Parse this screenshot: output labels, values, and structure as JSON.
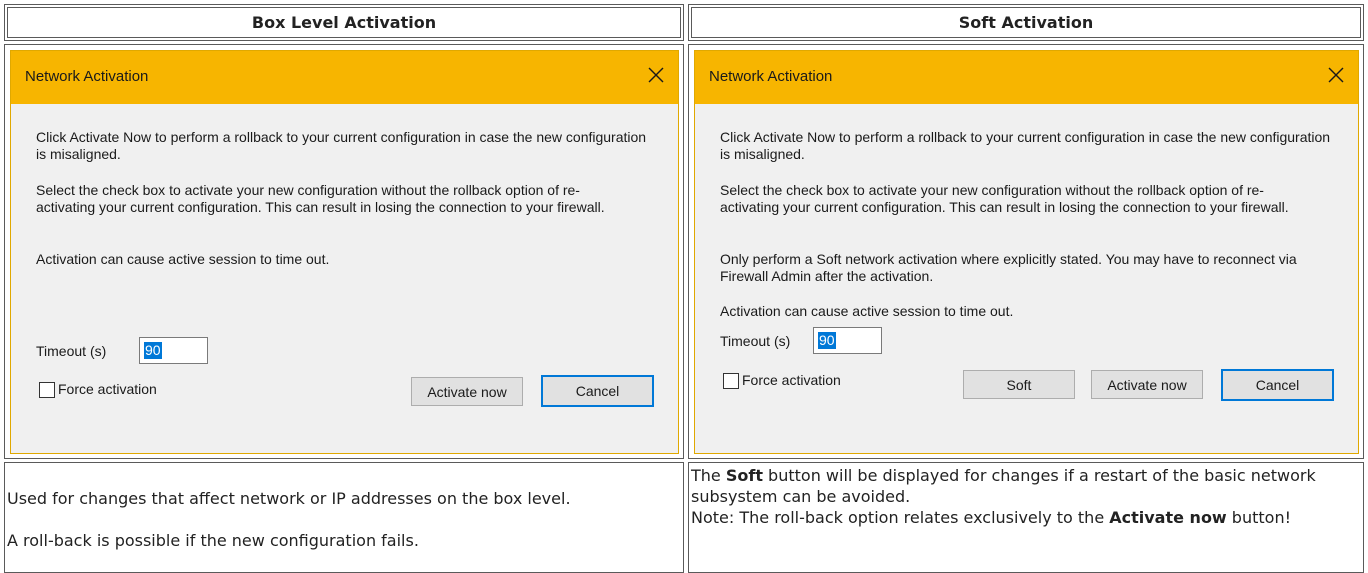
{
  "headers": {
    "left": "Box Level Activation",
    "right": "Soft Activation"
  },
  "left_dialog": {
    "title": "Network Activation",
    "close_icon": "close-icon",
    "paragraphs": [
      "Click Activate Now to perform a rollback to your current configuration in case the new configuration is misaligned.",
      "Select the check box to activate your new configuration without the rollback option of re-activating your current configuration. This can result in losing the connection to your firewall.",
      "Activation can cause active session to time out."
    ],
    "timeout_label": "Timeout (s)",
    "timeout_value": "90",
    "force_label": "Force activation",
    "activate_label": "Activate now",
    "cancel_label": "Cancel"
  },
  "right_dialog": {
    "title": "Network Activation",
    "close_icon": "close-icon",
    "paragraphs": [
      "Click Activate Now to perform a rollback to your current configuration in case the new configuration is misaligned.",
      "Select the check box to activate your new configuration without the rollback option of re-activating your current configuration. This can result in losing the connection to your firewall.",
      "Only perform a Soft network activation where explicitly stated. You may have to reconnect via Firewall Admin after the activation.",
      "Activation can cause active session to time out."
    ],
    "timeout_label": "Timeout (s)",
    "timeout_value": "90",
    "force_label": "Force activation",
    "soft_label": "Soft",
    "activate_label": "Activate now",
    "cancel_label": "Cancel"
  },
  "descriptions": {
    "left_line1": "Used for changes that affect network or IP addresses on the box level.",
    "left_line2": "A roll-back is possible if the new configuration fails.",
    "right_part1": "The ",
    "right_bold1": "Soft",
    "right_part2": " button will be displayed for changes if a restart of the basic network subsystem can be avoided.",
    "right_part3": "Note: The roll-back option relates exclusively to the ",
    "right_bold2": "Activate now",
    "right_part4": " button!"
  },
  "colors": {
    "titlebar": "#f7b500",
    "dialog_bg": "#f0f0f0",
    "selection": "#0078d7",
    "default_button_border": "#0078d7"
  }
}
